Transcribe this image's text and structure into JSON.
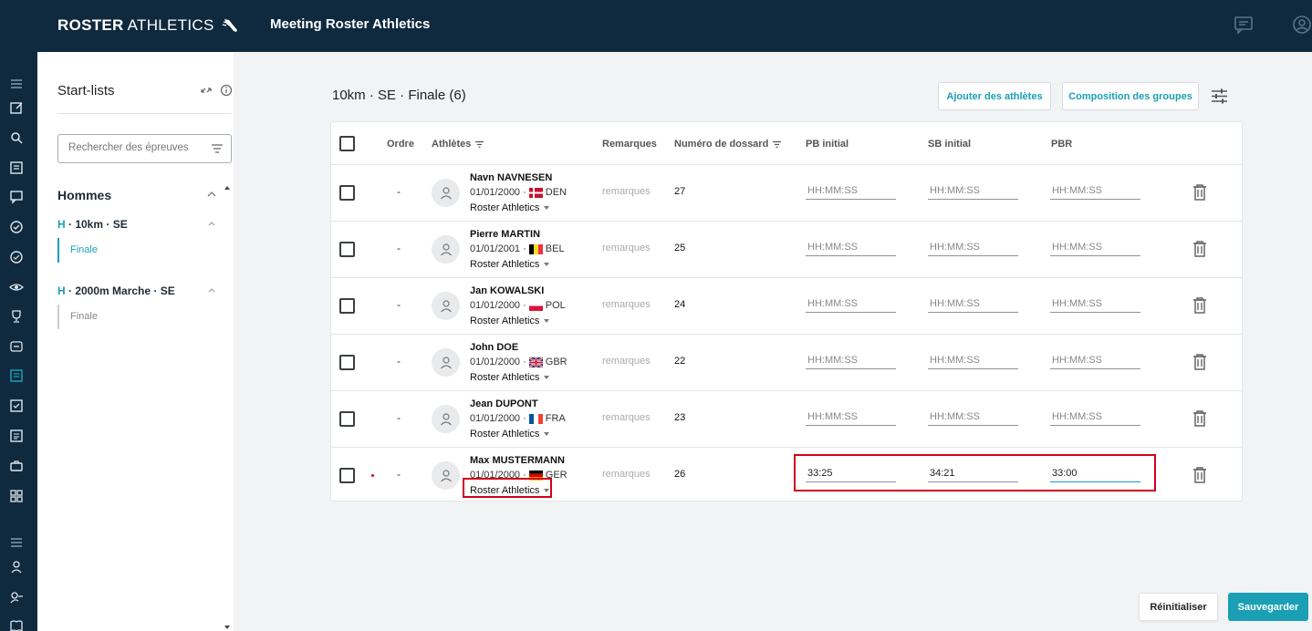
{
  "header": {
    "logo_bold": "ROSTER",
    "logo_light": "ATHLETICS",
    "title": "Meeting Roster Athletics"
  },
  "sidebar": {
    "title": "Start-lists",
    "search_placeholder": "Rechercher des épreuves",
    "group": "Hommes",
    "events": [
      {
        "prefix": "H",
        "name": " · 10km · SE",
        "sub": "Finale"
      },
      {
        "prefix": "H",
        "name": " · 2000m Marche · SE",
        "sub": "Finale"
      }
    ]
  },
  "main": {
    "title": "10km · SE · Finale (6)",
    "add_button": "Ajouter des athlètes",
    "groups_button": "Composition des groupes",
    "columns": {
      "order": "Ordre",
      "athletes": "Athlètes",
      "remarks": "Remarques",
      "bib": "Numéro de dossard",
      "pb": "PB initial",
      "sb": "SB initial",
      "pbr": "PBR"
    },
    "time_placeholder": "HH:MM:SS",
    "rows": [
      {
        "order": "-",
        "name": "Navn NAVNESEN",
        "dob": "01/01/2000 ·",
        "country": "DEN",
        "club": "Roster Athletics",
        "remarks": "remarques",
        "bib": "27",
        "pb": "",
        "sb": "",
        "pbr": ""
      },
      {
        "order": "-",
        "name": "Pierre MARTIN",
        "dob": "01/01/2001 ·",
        "country": "BEL",
        "club": "Roster Athletics",
        "remarks": "remarques",
        "bib": "25",
        "pb": "",
        "sb": "",
        "pbr": ""
      },
      {
        "order": "-",
        "name": "Jan KOWALSKI",
        "dob": "01/01/2000 ·",
        "country": "POL",
        "club": "Roster Athletics",
        "remarks": "remarques",
        "bib": "24",
        "pb": "",
        "sb": "",
        "pbr": ""
      },
      {
        "order": "-",
        "name": "John DOE",
        "dob": "01/01/2000 ·",
        "country": "GBR",
        "club": "Roster Athletics",
        "remarks": "remarques",
        "bib": "22",
        "pb": "",
        "sb": "",
        "pbr": ""
      },
      {
        "order": "-",
        "name": "Jean DUPONT",
        "dob": "01/01/2000 ·",
        "country": "FRA",
        "club": "Roster Athletics",
        "remarks": "remarques",
        "bib": "23",
        "pb": "",
        "sb": "",
        "pbr": ""
      },
      {
        "order": "-",
        "name": "Max MUSTERMANN",
        "dob": "01/01/2000 ·",
        "country": "GER",
        "club": "Roster Athletics",
        "remarks": "remarques",
        "bib": "26",
        "pb": "33:25",
        "sb": "34:21",
        "pbr": "33:00"
      }
    ]
  },
  "footer": {
    "reset_button": "Réinitialiser",
    "save_button": "Sauvegarder"
  },
  "colors": {
    "navy": "#0f2a3f",
    "accent": "#1a9fb5",
    "highlight": "#d0021b"
  }
}
